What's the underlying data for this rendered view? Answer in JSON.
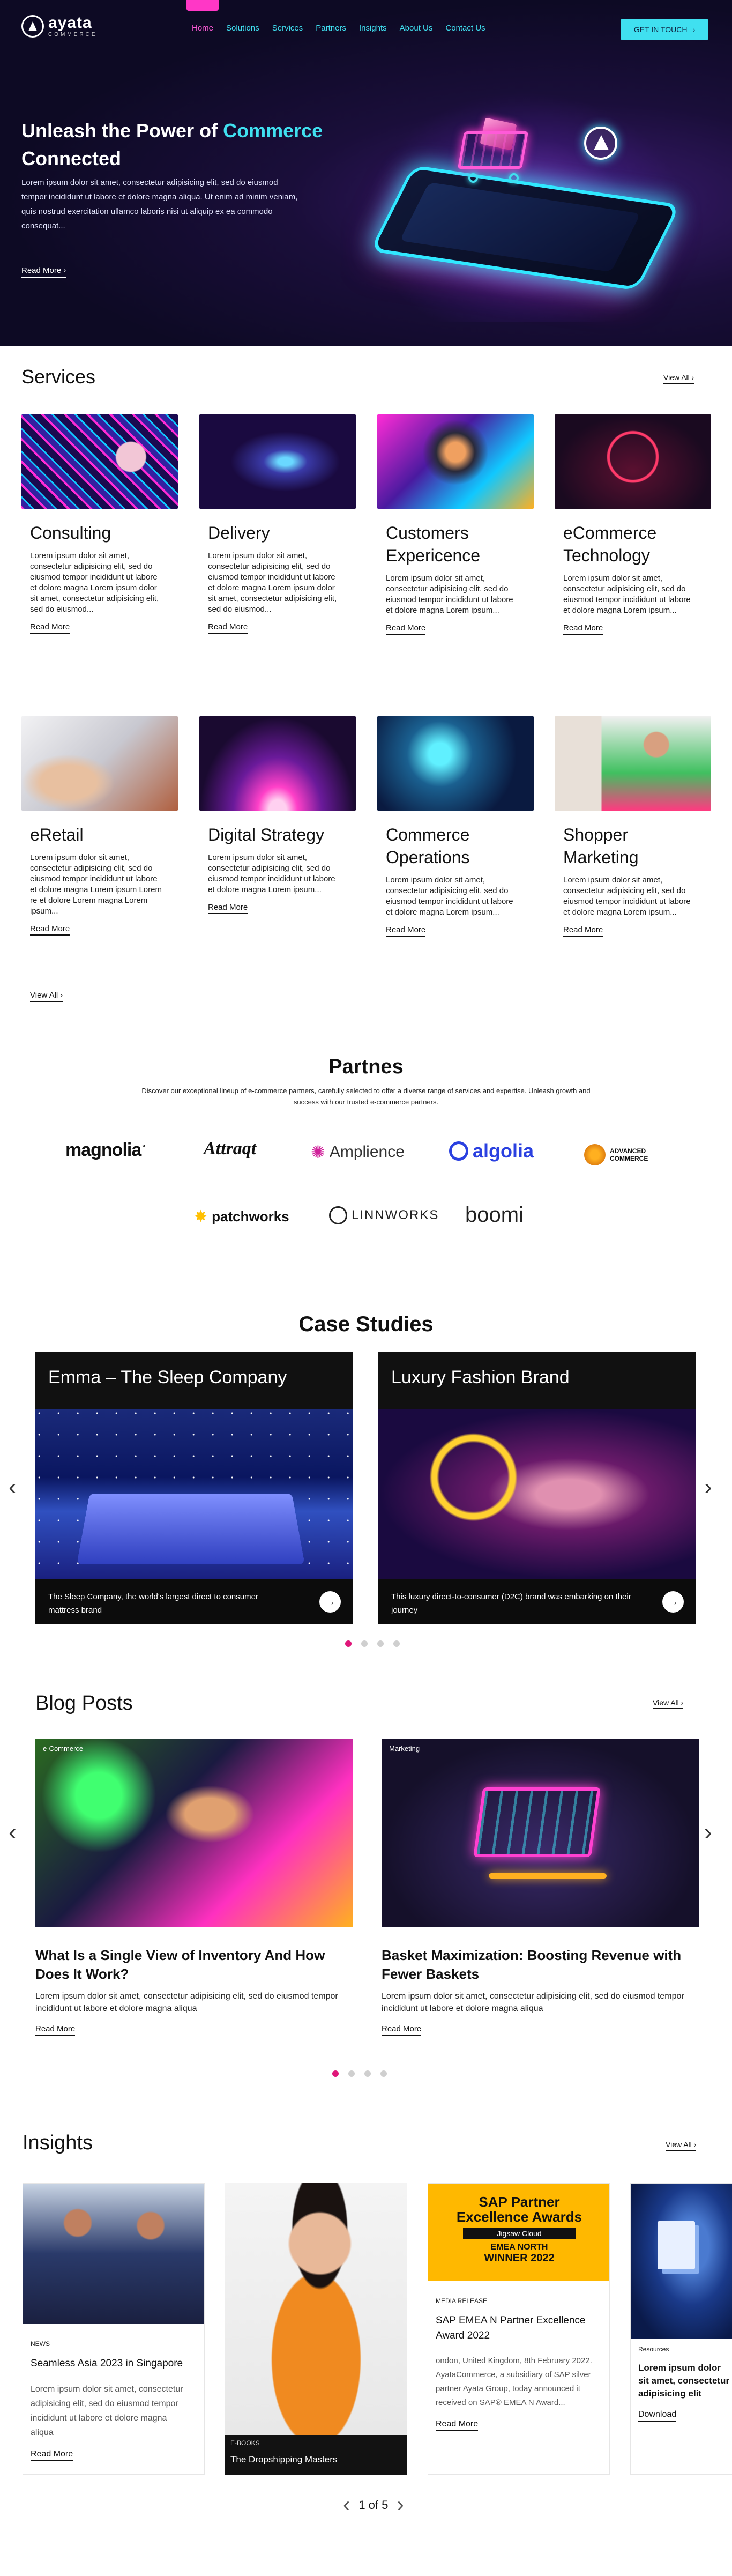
{
  "header": {
    "logo_name": "ayata",
    "logo_sub": "COMMERCE",
    "nav": [
      "Home",
      "Solutions",
      "Services",
      "Partners",
      "Insights",
      "About Us",
      "Contact Us"
    ],
    "cta": "GET IN TOUCH"
  },
  "hero": {
    "title_a": "Unleash the Power of",
    "title_accent": "Commerce",
    "title_b": "Connected",
    "body": "Lorem ipsum dolor sit amet, consectetur adipisicing elit, sed do eiusmod tempor incididunt ut labore et dolore magna aliqua. Ut enim ad minim veniam, quis nostrud exercitation ullamco laboris nisi ut aliquip ex ea commodo consequat...",
    "link": "Read More"
  },
  "services": {
    "title": "Services",
    "view_all_top": "View All",
    "view_all_bottom": "View All",
    "items": [
      {
        "title": "Consulting",
        "body": "Lorem ipsum dolor sit amet, consectetur adipisicing elit, sed do eiusmod tempor incididunt ut labore et dolore magna Lorem ipsum dolor sit amet, consectetur adipisicing elit, sed do eiusmod...",
        "link": "Read More"
      },
      {
        "title": "Delivery",
        "body": "Lorem ipsum dolor sit amet, consectetur adipisicing elit, sed do eiusmod tempor incididunt ut labore et dolore magna Lorem ipsum dolor sit amet, consectetur adipisicing elit, sed do eiusmod...",
        "link": "Read More"
      },
      {
        "title": "Customers Expericence",
        "body": "Lorem ipsum dolor sit amet, consectetur adipisicing elit, sed do eiusmod tempor incididunt ut labore et dolore magna Lorem ipsum...",
        "link": "Read More"
      },
      {
        "title": "eCommerce Technology",
        "body": "Lorem ipsum dolor sit amet, consectetur adipisicing elit, sed do eiusmod tempor incididunt ut labore et dolore magna Lorem ipsum...",
        "link": "Read More"
      },
      {
        "title": "eRetail",
        "body": "Lorem ipsum dolor sit amet, consectetur adipisicing elit, sed do eiusmod tempor incididunt ut labore et dolore magna Lorem ipsum Lorem re et dolore Lorem magna Lorem ipsum...",
        "link": "Read More"
      },
      {
        "title": "Digital Strategy",
        "body": "Lorem ipsum dolor sit amet, consectetur adipisicing elit, sed do eiusmod tempor incididunt ut labore et dolore magna Lorem ipsum...",
        "link": "Read More"
      },
      {
        "title": "Commerce Operations",
        "body": "Lorem ipsum dolor sit amet, consectetur adipisicing elit, sed do eiusmod tempor incididunt ut labore et dolore magna Lorem ipsum...",
        "link": "Read More"
      },
      {
        "title": "Shopper Marketing",
        "body": "Lorem ipsum dolor sit amet, consectetur adipisicing elit, sed do eiusmod tempor incididunt ut labore et dolore magna Lorem ipsum...",
        "link": "Read More"
      }
    ]
  },
  "partners": {
    "title": "Partnes",
    "desc": "Discover our exceptional lineup of e-commerce partners, carefully selected to offer a diverse range of services and expertise. Unleash growth and success with our trusted e-commerce partners.",
    "logos": [
      "magnolia",
      "Attraqt",
      "Amplience",
      "algolia",
      "ADVANCED COMMERCE",
      "patchworks",
      "LINNWORKS",
      "boomi"
    ]
  },
  "case_studies": {
    "title": "Case Studies",
    "items": [
      {
        "name": "Emma – The Sleep Company",
        "text": "The Sleep Company, the world's largest direct to consumer mattress brand"
      },
      {
        "name": "Luxury Fashion Brand",
        "text": "This luxury direct-to-consumer (D2C) brand was embarking on their journey"
      }
    ]
  },
  "blog": {
    "title": "Blog Posts",
    "view_all": "View All",
    "items": [
      {
        "category": "e-Commerce",
        "title": "What Is a Single View of Inventory And How Does It Work?",
        "body": "Lorem ipsum dolor sit amet, consectetur adipisicing elit, sed do eiusmod tempor incididunt ut labore et dolore magna aliqua",
        "link": "Read More"
      },
      {
        "category": "Marketing",
        "title": "Basket Maximization: Boosting Revenue with Fewer Baskets",
        "body": "Lorem ipsum dolor sit amet, consectetur adipisicing elit, sed do eiusmod tempor incididunt ut labore et dolore magna aliqua",
        "link": "Read More"
      }
    ]
  },
  "insights": {
    "title": "Insights",
    "view_all": "View All",
    "items": [
      {
        "type": "NEWS",
        "title": "Seamless Asia 2023 in Singapore",
        "body": "Lorem ipsum dolor sit amet, consectetur adipisicing elit, sed do eiusmod tempor incididunt ut labore et dolore magna aliqua",
        "link": "Read More"
      },
      {
        "type": "E-BOOKS",
        "title": "The Dropshipping Masters"
      },
      {
        "type": "MEDIA RELEASE",
        "title": "SAP EMEA N Partner Excellence Award 2022",
        "body": "ondon, United Kingdom, 8th February 2022. AyataCommerce, a subsidiary of SAP silver partner Ayata Group, today announced it received on SAP® EMEA N Award...",
        "link": "Read More",
        "award": {
          "l1": "SAP Partner",
          "l2": "Excellence Awards",
          "l3": "Jigsaw Cloud",
          "l4": "EMEA NORTH",
          "l5": "WINNER 2022"
        }
      },
      {
        "type": "Resources",
        "title": "Lorem ipsum dolor sit amet, consectetur adipisicing elit",
        "link": "Download"
      }
    ],
    "pager": "1 of 5"
  },
  "colors": {
    "accent_cyan": "#40e0f0",
    "accent_pink": "#ff37c6",
    "dot_active": "#e0177a"
  }
}
